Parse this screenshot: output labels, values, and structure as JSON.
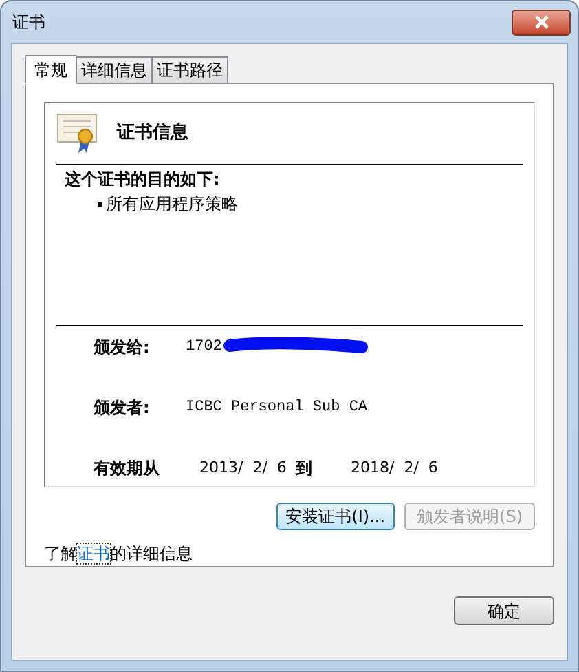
{
  "window": {
    "title": "证书"
  },
  "tabs": [
    {
      "label": "常规",
      "selected": true
    },
    {
      "label": "详细信息",
      "selected": false
    },
    {
      "label": "证书路径",
      "selected": false
    }
  ],
  "certificate": {
    "heading": "证书信息",
    "purpose_title": "这个证书的目的如下:",
    "purposes": [
      "所有应用程序策略"
    ],
    "issued_to_label": "颁发给:",
    "issued_to": "1702",
    "issued_by_label": "颁发者:",
    "issued_by": "ICBC Personal Sub CA",
    "valid_from_label": "有效期从",
    "valid_from": "2013/  2/  6",
    "valid_to_label": "到",
    "valid_to": "2018/  2/  6"
  },
  "buttons": [
    {
      "label": "安装证书(I)...",
      "disabled": false
    },
    {
      "label": "颁发者说明(S)",
      "disabled": true
    }
  ],
  "info_link": {
    "before": "了解",
    "link": "证书",
    "after": "的详细信息"
  },
  "ok_button": "确定"
}
